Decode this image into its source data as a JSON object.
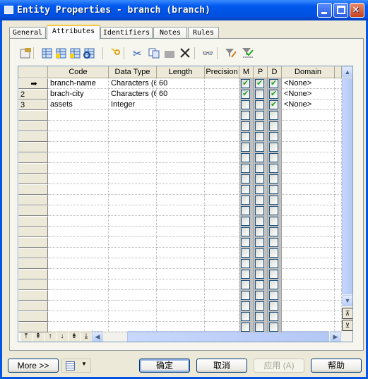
{
  "window": {
    "title": "Entity Properties - branch (branch)"
  },
  "tabs": [
    {
      "label": "General"
    },
    {
      "label": "Attributes",
      "selected": true
    },
    {
      "label": "Identifiers"
    },
    {
      "label": "Notes"
    },
    {
      "label": "Rules"
    }
  ],
  "toolbar_icons": [
    "properties-icon",
    "insert-row-icon",
    "add-row-icon",
    "add-attributes-icon",
    "reuse-attributes-icon",
    "key-icon",
    "cut-icon",
    "copy-icon",
    "paste-icon",
    "delete-icon",
    "find-icon",
    "filter-edit-icon",
    "filter-apply-icon"
  ],
  "grid": {
    "columns": [
      "Code",
      "Data Type",
      "Length",
      "Precision",
      "M",
      "P",
      "D",
      "Domain"
    ],
    "rows": [
      {
        "indicator": "➡",
        "code": "branch-name",
        "data_type": "Characters (6",
        "length": "60",
        "precision": "",
        "M": true,
        "P": true,
        "D": true,
        "domain": "<None>"
      },
      {
        "indicator": "2",
        "code": "brach-city",
        "data_type": "Characters (6",
        "length": "60",
        "precision": "",
        "M": true,
        "P": false,
        "D": true,
        "domain": "<None>"
      },
      {
        "indicator": "3",
        "code": "assets",
        "data_type": "Integer",
        "length": "",
        "precision": "",
        "M": false,
        "P": false,
        "D": true,
        "domain": "<None>"
      }
    ]
  },
  "nav_buttons": [
    "⤒",
    "⇞",
    "↑",
    "↓",
    "⇟",
    "⤓"
  ],
  "buttons": {
    "more": "More >>",
    "ok": "确定",
    "cancel": "取消",
    "apply": "应用 (A)",
    "help": "帮助"
  }
}
